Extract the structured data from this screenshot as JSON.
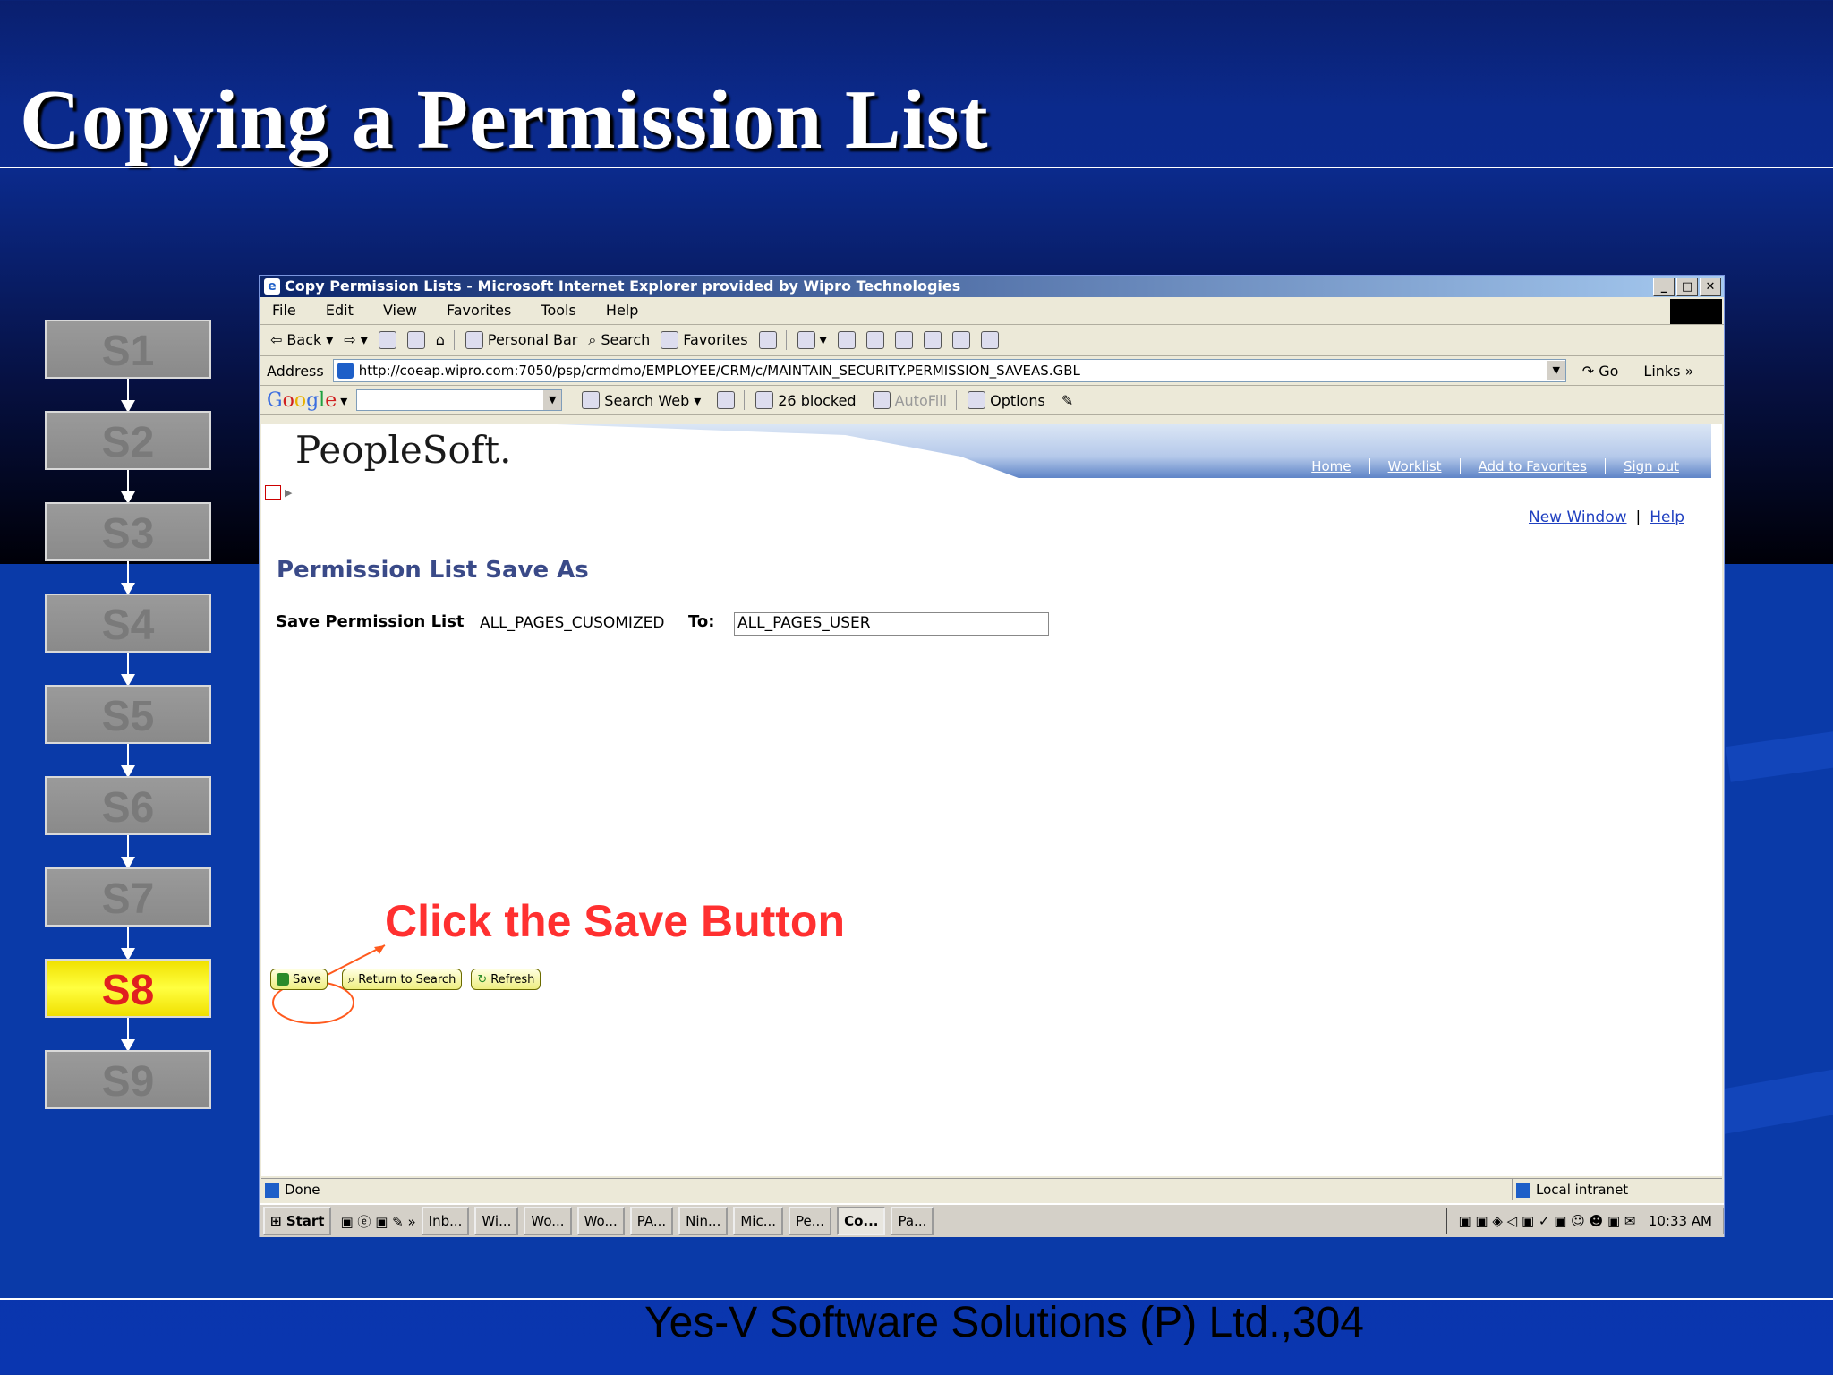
{
  "slide": {
    "title": "Copying a Permission List",
    "footer": "Yes-V Software Solutions (P) Ltd.,304",
    "callout": "Click the Save Button"
  },
  "steps": [
    "S1",
    "S2",
    "S3",
    "S4",
    "S5",
    "S6",
    "S7",
    "S8",
    "S9"
  ],
  "active_step": "S8",
  "browser": {
    "window_title": "Copy Permission Lists - Microsoft Internet Explorer provided by Wipro Technologies",
    "menu": [
      "File",
      "Edit",
      "View",
      "Favorites",
      "Tools",
      "Help"
    ],
    "toolbar": {
      "back": "Back",
      "personal_bar": "Personal Bar",
      "search": "Search",
      "favorites": "Favorites"
    },
    "address_label": "Address",
    "address_url": "http://coeap.wipro.com:7050/psp/crmdmo/EMPLOYEE/CRM/c/MAINTAIN_SECURITY.PERMISSION_SAVEAS.GBL",
    "go": "Go",
    "links": "Links",
    "google": {
      "logo": "Google",
      "search_web": "Search Web",
      "blocked": "26 blocked",
      "autofill": "AutoFill",
      "options": "Options"
    },
    "status": "Done",
    "zone": "Local intranet"
  },
  "peoplesoft": {
    "logo": "PeopleSoft.",
    "nav": [
      "Home",
      "Worklist",
      "Add to Favorites",
      "Sign out"
    ],
    "new_window": "New Window",
    "help": "Help",
    "page_title": "Permission List Save As",
    "save_label": "Save Permission List",
    "source_value": "ALL_PAGES_CUSOMIZED",
    "to_label": "To:",
    "target_value": "ALL_PAGES_USER",
    "buttons": {
      "save": "Save",
      "return": "Return to Search",
      "refresh": "Refresh"
    }
  },
  "taskbar": {
    "start": "Start",
    "tasks": [
      "Inb...",
      "Wi...",
      "Wo...",
      "Wo...",
      "PA...",
      "Nin...",
      "Mic...",
      "Pe...",
      "Co...",
      "Pa..."
    ],
    "clock": "10:33 AM"
  },
  "colors": {
    "callout": "#ff3030",
    "active_step": "#f0e000",
    "page_title": "#3a4a88"
  }
}
